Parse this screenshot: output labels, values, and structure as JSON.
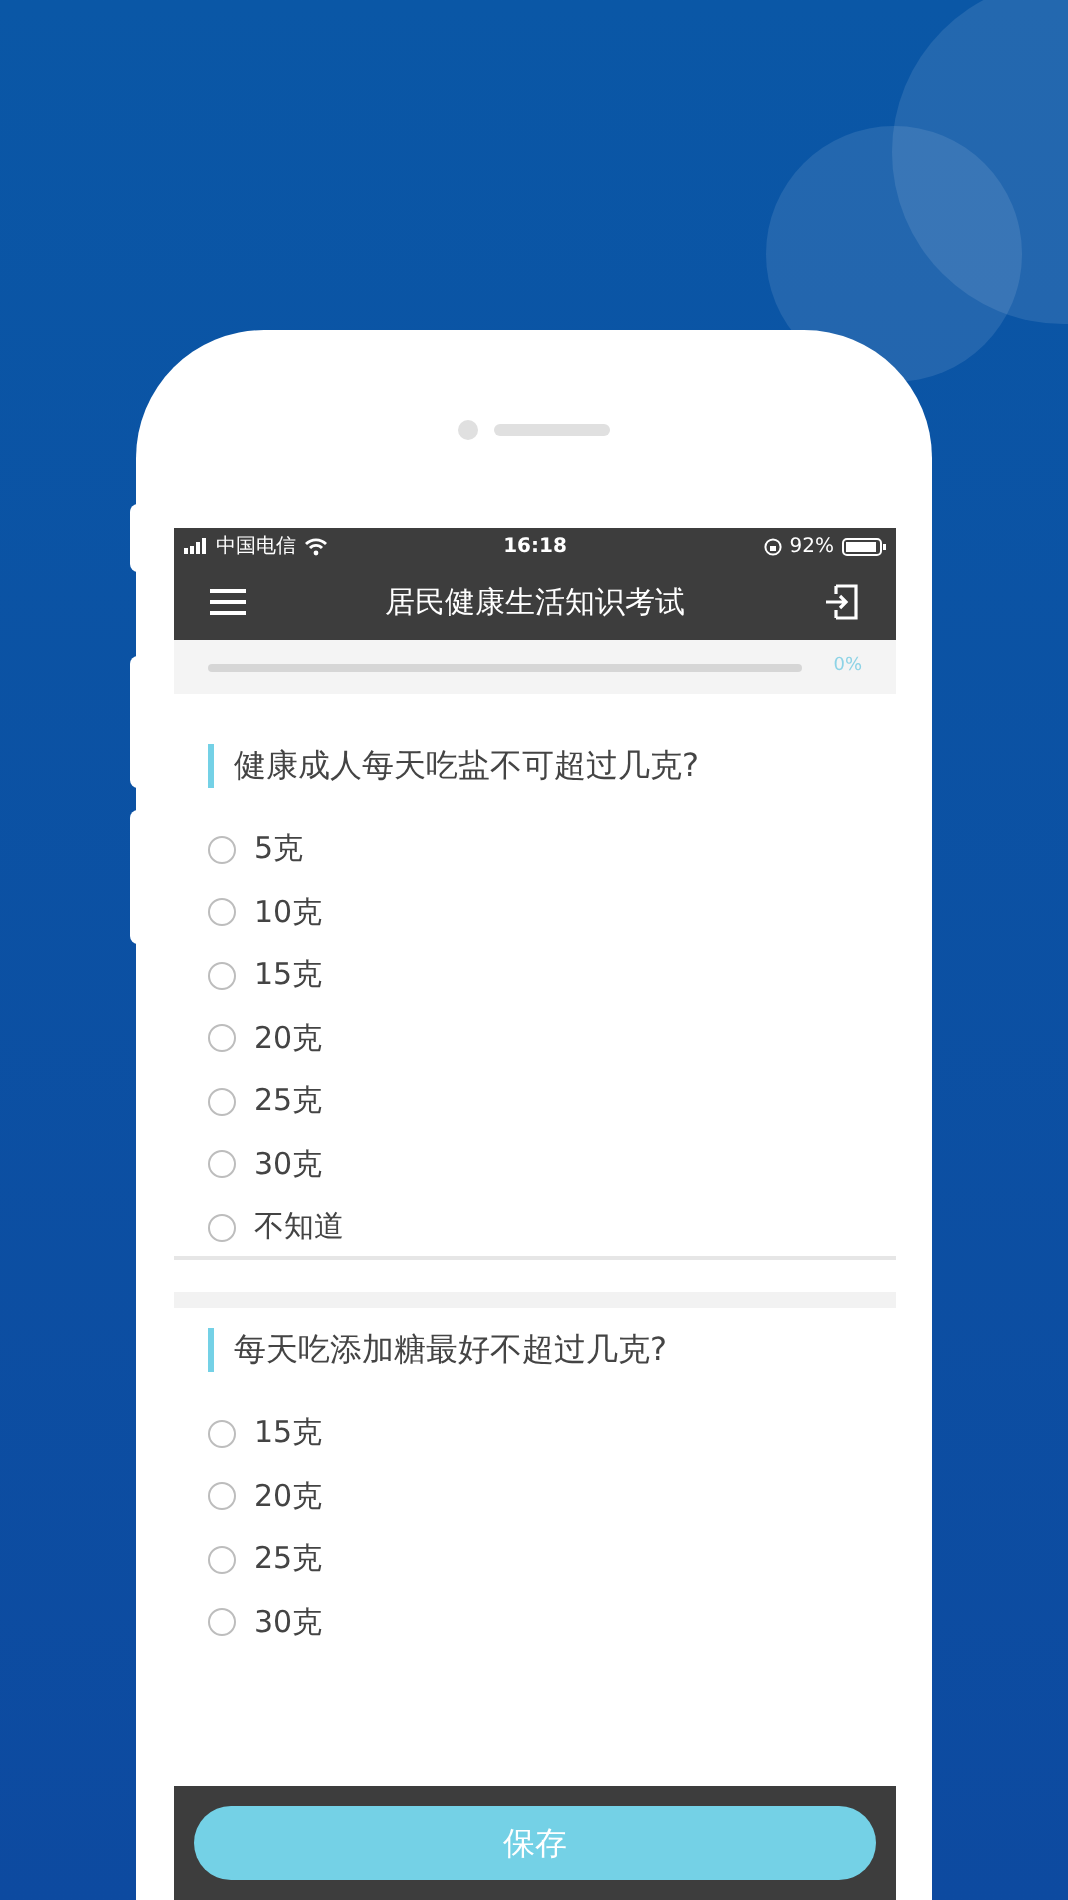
{
  "status_bar": {
    "carrier": "中国电信",
    "time": "16:18",
    "battery": "92%"
  },
  "nav": {
    "title": "居民健康生活知识考试"
  },
  "progress": {
    "level": 0,
    "reading": "0%"
  },
  "questions": [
    {
      "text": "健康成人每天吃盐不可超过几克?",
      "options": [
        {
          "label": "5克",
          "selected": false
        },
        {
          "label": "10克",
          "selected": false
        },
        {
          "label": "15克",
          "selected": false
        },
        {
          "label": "20克",
          "selected": false
        },
        {
          "label": "25克",
          "selected": false
        },
        {
          "label": "30克",
          "selected": false
        },
        {
          "label": "不知道",
          "selected": false
        }
      ]
    },
    {
      "text": "每天吃添加糖最好不超过几克?",
      "options": [
        {
          "label": "15克",
          "selected": false
        },
        {
          "label": "20克",
          "selected": false
        },
        {
          "label": "25克",
          "selected": false
        },
        {
          "label": "30克",
          "selected": false
        }
      ]
    }
  ],
  "save_button": "保存"
}
